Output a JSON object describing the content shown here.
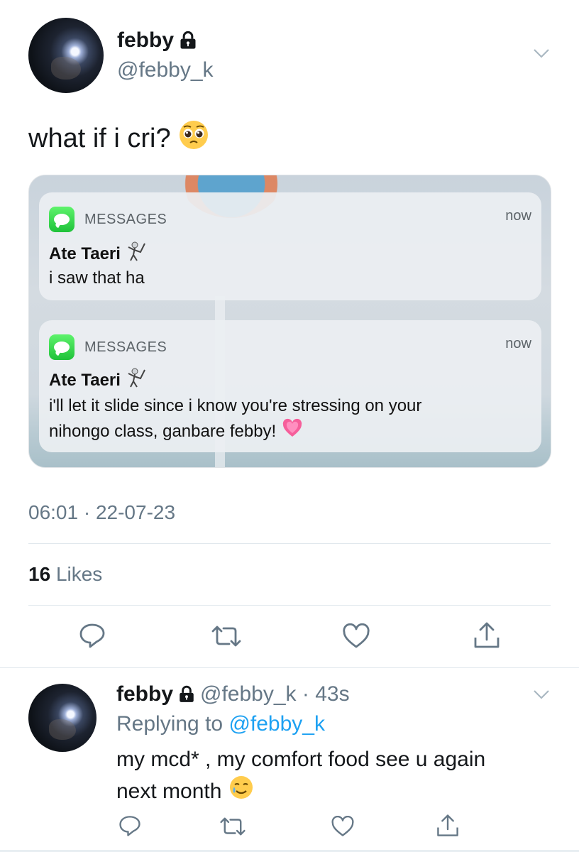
{
  "tweet": {
    "display_name": "febby",
    "handle": "@febby_k",
    "text": "what if i cri?",
    "timestamp": "06:01 · 22-07-23",
    "likes_count": "16",
    "likes_label": "Likes",
    "media": {
      "notifications": [
        {
          "app_name": "MESSAGES",
          "time": "now",
          "sender": "Ate Taeri",
          "lines": [
            "i saw that ha"
          ]
        },
        {
          "app_name": "MESSAGES",
          "time": "now",
          "sender": "Ate Taeri",
          "lines": [
            "i'll let it slide since i know you're stressing on your",
            "nihongo class, ganbare febby!"
          ]
        }
      ]
    }
  },
  "reply": {
    "display_name": "febby",
    "handle_time": "@febby_k · 43s",
    "replying_prefix": "Replying to",
    "replying_mention": "@febby_k",
    "text_line1": "my mcd* , my comfort food see u again",
    "text_line2": "next month"
  },
  "icons": {
    "lock": "lock-icon",
    "chevron": "chevron-down-icon",
    "reply": "reply-icon",
    "retweet": "retweet-icon",
    "like": "heart-icon",
    "share": "share-icon"
  },
  "colors": {
    "accent": "#1da1f2",
    "secondary_text": "#657786",
    "icon_gray": "#657786",
    "imessage_green": "#34c759"
  }
}
